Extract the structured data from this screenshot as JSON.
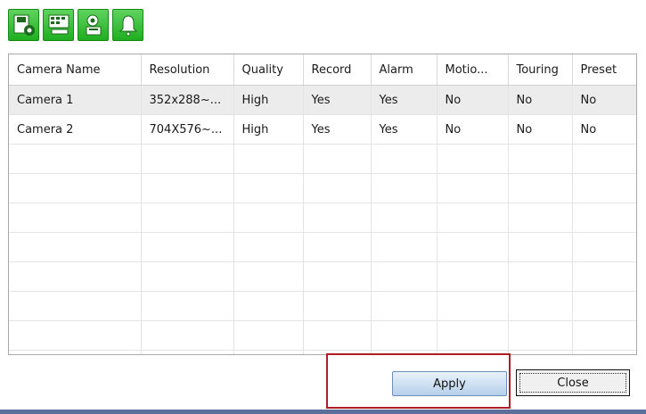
{
  "toolbar": {
    "buttons": [
      {
        "icon": "save-settings-icon",
        "color": "#2fbf2f"
      },
      {
        "icon": "network-device-icon",
        "color": "#2fbf2f"
      },
      {
        "icon": "camera-record-icon",
        "color": "#2fbf2f"
      },
      {
        "icon": "alarm-bell-icon",
        "color": "#2fbf2f"
      }
    ]
  },
  "table": {
    "columns": [
      "Camera Name",
      "Resolution",
      "Quality",
      "Record",
      "Alarm",
      "Motio...",
      "Touring",
      "Preset"
    ],
    "rows": [
      [
        "Camera 1",
        "352x288~...",
        "High",
        "Yes",
        "Yes",
        "No",
        "No",
        "No"
      ],
      [
        "Camera 2",
        "704X576~...",
        "High",
        "Yes",
        "Yes",
        "No",
        "No",
        "No"
      ]
    ],
    "selected_row": 0
  },
  "buttons": {
    "apply": "Apply",
    "close": "Close"
  },
  "colors": {
    "toolbar_green": "#2fbf2f",
    "highlight_red": "#b01e24",
    "selected_row": "#ececec"
  }
}
